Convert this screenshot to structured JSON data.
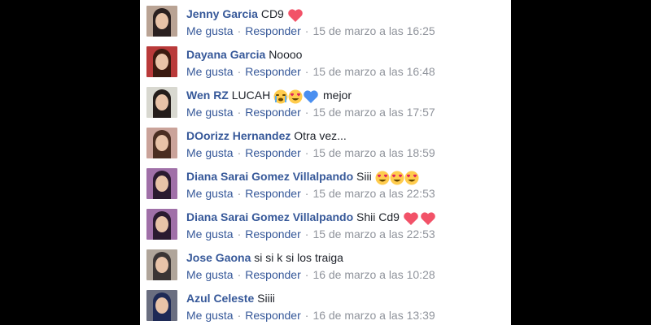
{
  "comments": [
    {
      "author": "Jenny Garcia",
      "text": "CD9",
      "emojis": [
        "heart-icon"
      ],
      "like": "Me gusta",
      "reply": "Responder",
      "time": "15 de marzo a las 16:25",
      "avatar_bg": "#b9a394",
      "avatar_hair": "#2a2020"
    },
    {
      "author": "Dayana Garcia",
      "text": "Noooo",
      "emojis": [],
      "like": "Me gusta",
      "reply": "Responder",
      "time": "15 de marzo a las 16:48",
      "avatar_bg": "#b93a3a",
      "avatar_hair": "#3a1a10"
    },
    {
      "author": "Wen RZ",
      "text": "LUCAH",
      "emojis": [
        "crying-face-icon",
        "heart-eyes-icon",
        "blue-heart-icon"
      ],
      "after": "mejor",
      "like": "Me gusta",
      "reply": "Responder",
      "time": "15 de marzo a las 17:57",
      "avatar_bg": "#d8d8d0",
      "avatar_hair": "#241d1b"
    },
    {
      "author": "DOorizz Hernandez",
      "text": "Otra vez...",
      "emojis": [],
      "like": "Me gusta",
      "reply": "Responder",
      "time": "15 de marzo a las 18:59",
      "avatar_bg": "#caa39a",
      "avatar_hair": "#4a2e22"
    },
    {
      "author": "Diana Sarai Gomez Villalpando",
      "text": "Siii",
      "emojis": [
        "heart-eyes-icon",
        "heart-eyes-icon",
        "heart-eyes-icon"
      ],
      "like": "Me gusta",
      "reply": "Responder",
      "time": "15 de marzo a las 22:53",
      "avatar_bg": "#a070a8",
      "avatar_hair": "#2a1a30"
    },
    {
      "author": "Diana Sarai Gomez Villalpando",
      "text": "Shii Cd9",
      "emojis": [
        "heart-icon",
        "heart-icon"
      ],
      "like": "Me gusta",
      "reply": "Responder",
      "time": "15 de marzo a las 22:53",
      "avatar_bg": "#a070a8",
      "avatar_hair": "#2a1a30"
    },
    {
      "author": "Jose Gaona",
      "text": "si si k si los traiga",
      "emojis": [],
      "like": "Me gusta",
      "reply": "Responder",
      "time": "16 de marzo a las 10:28",
      "avatar_bg": "#b0a59a",
      "avatar_hair": "#3b3535"
    },
    {
      "author": "Azul Celeste",
      "text": "Siiii",
      "emojis": [],
      "like": "Me gusta",
      "reply": "Responder",
      "time": "16 de marzo a las 13:39",
      "avatar_bg": "#6a6e80",
      "avatar_hair": "#1e2a56"
    }
  ],
  "colors": {
    "link": "#365899",
    "meta": "#90949c",
    "heart": "#f25268",
    "blue_heart": "#4a8ff0",
    "emoji_face": "#ffcc4d"
  }
}
